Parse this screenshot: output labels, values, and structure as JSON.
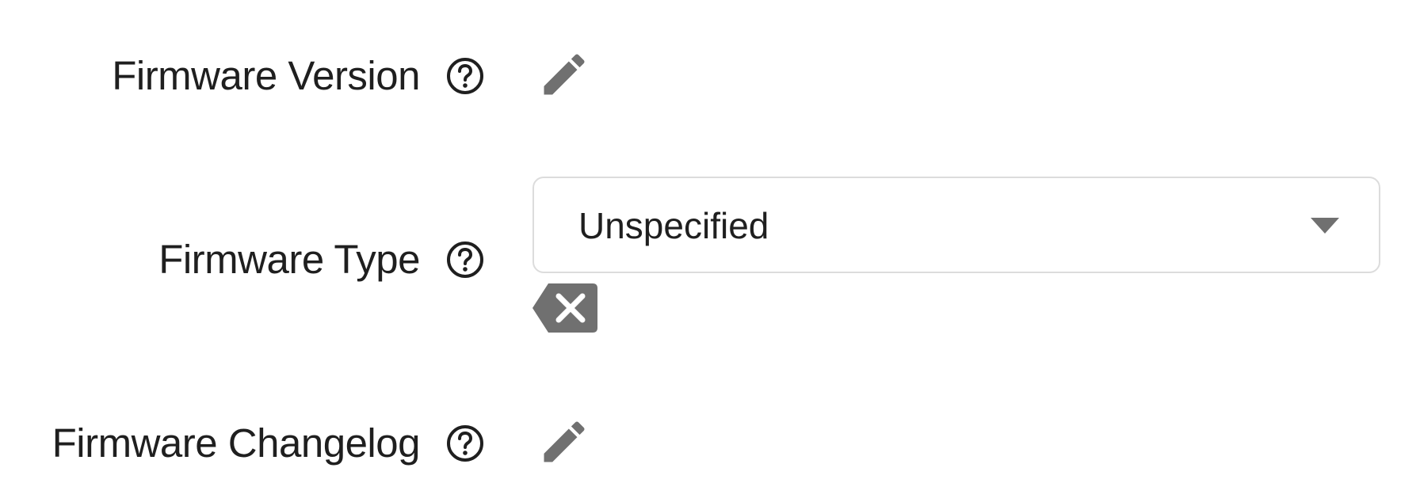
{
  "colors": {
    "text": "#1f1f1f",
    "icon": "#707070",
    "border": "#dcdcdc"
  },
  "fields": {
    "firmware_version": {
      "label": "Firmware Version",
      "help_icon": "help-circle-icon",
      "action_icon": "pencil-edit-icon"
    },
    "firmware_type": {
      "label": "Firmware Type",
      "help_icon": "help-circle-icon",
      "select_value": "Unspecified",
      "select_icon": "dropdown-arrow-icon",
      "clear_icon": "backspace-clear-icon"
    },
    "firmware_changelog": {
      "label": "Firmware Changelog",
      "help_icon": "help-circle-icon",
      "action_icon": "pencil-edit-icon"
    }
  }
}
